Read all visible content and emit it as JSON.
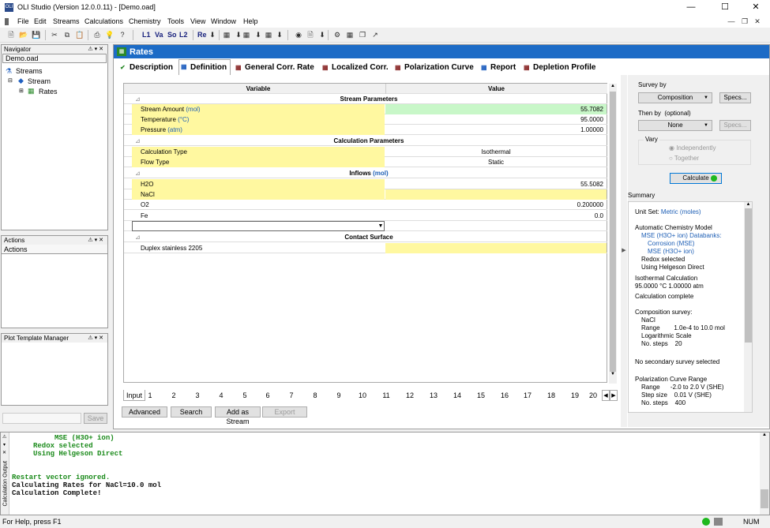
{
  "window": {
    "title": "OLI Studio (Version 12.0.0.11) - [Demo.oad]",
    "app_icon": "OLI"
  },
  "menu": [
    "File",
    "Edit",
    "Streams",
    "Calculations",
    "Chemistry",
    "Tools",
    "View",
    "Window",
    "Help"
  ],
  "toolbar": {
    "l1": "L1",
    "va": "Va",
    "so": "So",
    "l2": "L2",
    "re": "Re"
  },
  "navigator": {
    "title": "Navigator",
    "file": "Demo.oad",
    "items": [
      "Streams",
      "Stream",
      "Rates"
    ]
  },
  "actions": {
    "title": "Actions",
    "header": "Actions"
  },
  "plot_template": {
    "title": "Plot Template Manager",
    "save": "Save"
  },
  "doc": {
    "title": "Rates"
  },
  "tabs": [
    "Description",
    "Definition",
    "General Corr. Rate",
    "Localized Corr.",
    "Polarization Curve",
    "Report",
    "Depletion Profile"
  ],
  "grid": {
    "col_variable": "Variable",
    "col_value": "Value",
    "sec_stream": "Stream Parameters",
    "stream_amount": "Stream Amount",
    "stream_amount_unit": "(mol)",
    "stream_amount_val": "55.7082",
    "temperature": "Temperature",
    "temperature_unit": "(°C)",
    "temperature_val": "95.0000",
    "pressure": "Pressure",
    "pressure_unit": "(atm)",
    "pressure_val": "1.00000",
    "sec_calc": "Calculation Parameters",
    "calc_type": "Calculation Type",
    "calc_type_val": "Isothermal",
    "flow_type": "Flow Type",
    "flow_type_val": "Static",
    "sec_inflows": "Inflows",
    "sec_inflows_unit": "(mol)",
    "h2o": "H2O",
    "h2o_val": "55.5082",
    "nacl": "NaCl",
    "nacl_val": "",
    "o2": "O2",
    "o2_val": "0.200000",
    "fe": "Fe",
    "fe_val": "0.0",
    "sec_contact": "Contact Surface",
    "surface": "Duplex stainless 2205"
  },
  "bottom_tabs": [
    "Input",
    "1",
    "2",
    "3",
    "4",
    "5",
    "6",
    "7",
    "8",
    "9",
    "10",
    "11",
    "12",
    "13",
    "14",
    "15",
    "16",
    "17",
    "18",
    "19",
    "20"
  ],
  "buttons": {
    "advanced": "Advanced",
    "search": "Search",
    "add_stream": "Add as Stream",
    "export": "Export"
  },
  "right": {
    "survey_by": "Survey by",
    "survey_val": "Composition",
    "specs": "Specs...",
    "then_by": "Then by",
    "optional": "(optional)",
    "then_val": "None",
    "specs2": "Specs...",
    "vary": "Vary",
    "independently": "Independently",
    "together": "Together",
    "calculate": "Calculate",
    "summary": "Summary"
  },
  "summary_lines": [
    "Unit Set: ",
    "Metric (moles)",
    "Automatic Chemistry Model",
    "MSE (H3O+ ion) Databanks:",
    "Corrosion (MSE)",
    "MSE (H3O+ ion)",
    "Redox selected",
    "Using Helgeson Direct",
    "Isothermal Calculation",
    "95.0000 °C 1.00000 atm",
    "Calculation complete",
    "Composition survey:",
    "NaCl",
    "Range        1.0e-4 to 10.0 mol",
    "Logarithmic Scale",
    "No. steps    20",
    "No secondary survey selected",
    "Polarization Curve Range",
    "Range      -2.0 to 2.0 V (SHE)",
    "Step size    0.01 V (SHE)",
    "No. steps    400"
  ],
  "output": {
    "title": "Calculation Output",
    "lines": [
      "          MSE (H3O+ ion)",
      "     Redox selected",
      "     Using Helgeson Direct",
      "",
      "",
      "Restart vector ignored.",
      "Calculating Rates for NaCl=10.0 mol",
      "Calculation Complete!"
    ]
  },
  "status": {
    "left": "For Help, press F1",
    "num": "NUM"
  }
}
